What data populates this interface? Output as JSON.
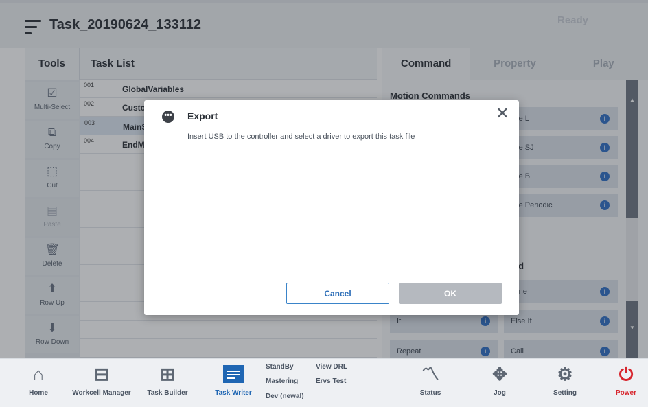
{
  "header": {
    "title": "Task_20190624_133112",
    "status": "Ready"
  },
  "tools": {
    "title": "Tools",
    "items": [
      {
        "label": "Multi-Select",
        "icon": "multi-select-icon",
        "glyph": "☑"
      },
      {
        "label": "Copy",
        "icon": "copy-icon",
        "glyph": "⧉"
      },
      {
        "label": "Cut",
        "icon": "cut-icon",
        "glyph": "⬚"
      },
      {
        "label": "Paste",
        "icon": "paste-icon",
        "glyph": "▤"
      },
      {
        "label": "Delete",
        "icon": "trash-icon",
        "glyph": "🗑"
      },
      {
        "label": "Row Up",
        "icon": "row-up-icon",
        "glyph": "⬆"
      },
      {
        "label": "Row Down",
        "icon": "row-down-icon",
        "glyph": "⬇"
      }
    ]
  },
  "task_list": {
    "title": "Task List",
    "rows": [
      {
        "num": "001",
        "name": "GlobalVariables"
      },
      {
        "num": "002",
        "name": "Custo"
      },
      {
        "num": "003",
        "name": "MainS"
      },
      {
        "num": "004",
        "name": "EndM"
      }
    ]
  },
  "right_panel": {
    "tabs": [
      "Command",
      "Property",
      "Play"
    ],
    "section_title": "Motion Commands",
    "motion_buttons": [
      "ove L",
      "ove SJ",
      "ove B",
      "ove Periodic"
    ],
    "flow_section_title": "and",
    "flow_buttons": {
      "define": "efine",
      "if": "If",
      "else_if": "Else If",
      "repeat": "Repeat",
      "call": "Call"
    },
    "info_glyph": "i"
  },
  "modal": {
    "title": "Export",
    "message": "Insert USB to the controller and select a driver to export this task file",
    "cancel_label": "Cancel",
    "ok_label": "OK",
    "close_glyph": "✕",
    "title_icon_glyph": "•••"
  },
  "bottom_bar": {
    "items": [
      {
        "label": "Home",
        "icon": "home-icon",
        "glyph": "⌂"
      },
      {
        "label": "Workcell Manager",
        "icon": "workcell-manager-icon",
        "glyph": "⊟"
      },
      {
        "label": "Task Builder",
        "icon": "task-builder-icon",
        "glyph": "⊞"
      },
      {
        "label": "Task Writer",
        "icon": "task-writer-icon"
      }
    ],
    "modes": {
      "standby": "StandBy",
      "mastering": "Mastering",
      "dev": "Dev (newal)",
      "view_drl": "View DRL",
      "ervs_test": "Ervs Test"
    },
    "right_items": [
      {
        "label": "Status",
        "icon": "status-icon",
        "glyph": "〽"
      },
      {
        "label": "Jog",
        "icon": "jog-icon",
        "glyph": "✥"
      },
      {
        "label": "Setting",
        "icon": "gear-icon",
        "glyph": "⚙"
      },
      {
        "label": "Power",
        "icon": "power-icon",
        "glyph": "⏻"
      }
    ]
  },
  "colors": {
    "accent": "#1f66b3",
    "power": "#d7262e",
    "info": "#2e6fc6"
  }
}
